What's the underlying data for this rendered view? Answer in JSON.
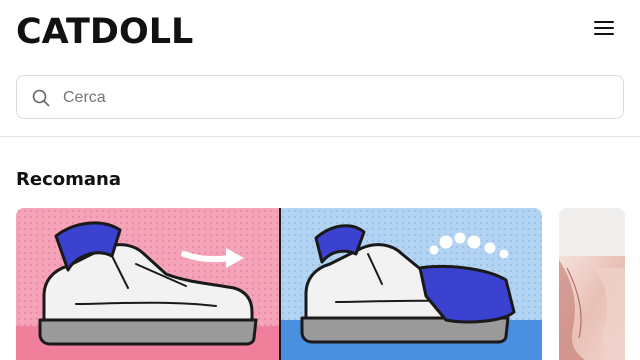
{
  "header": {
    "logo": "CATDOLL",
    "menu_icon": "hamburger-menu-icon"
  },
  "search": {
    "placeholder": "Cerca",
    "value": "",
    "icon": "search-icon"
  },
  "section": {
    "title": "Recomana"
  },
  "cards": [
    {
      "image": "sneaker-cleaning-illustration"
    },
    {
      "image": "partial-product-photo"
    }
  ],
  "colors": {
    "pink_panel": "#f29bb2",
    "blue_panel": "#a9cdf0",
    "towel_blue": "#3c42d0"
  }
}
